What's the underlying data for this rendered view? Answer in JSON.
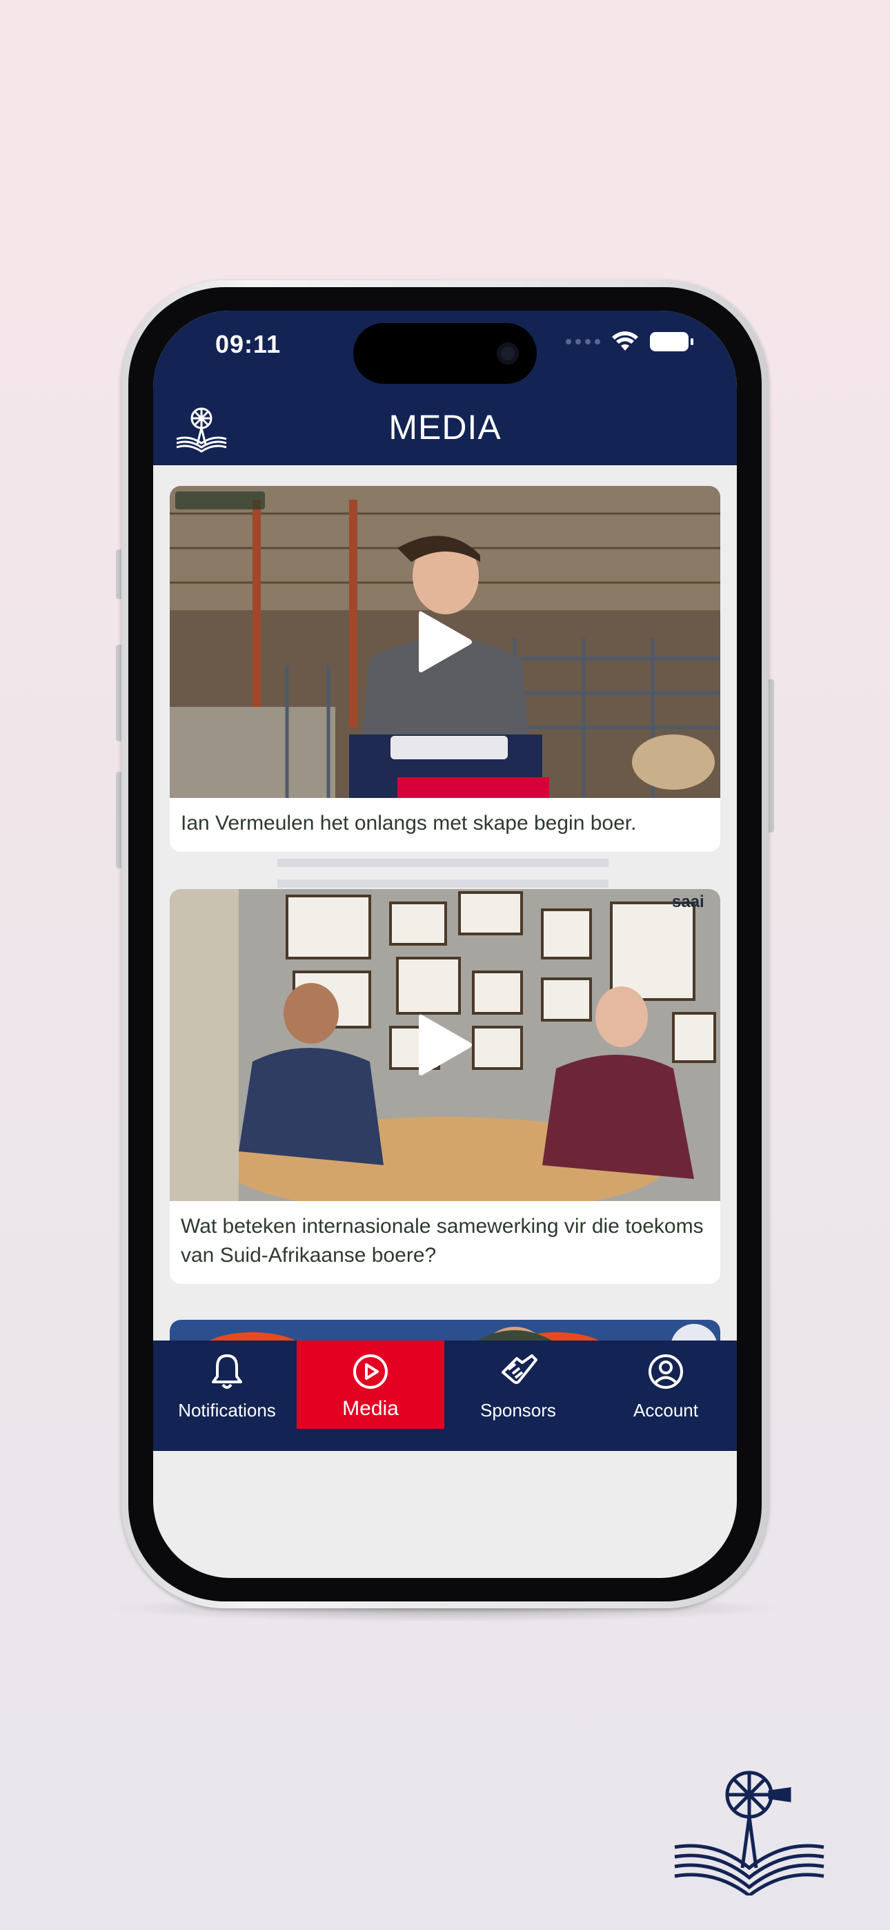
{
  "status_bar": {
    "time": "09:11"
  },
  "header": {
    "title": "MEDIA"
  },
  "videos": [
    {
      "caption": "Ian Vermeulen het onlangs met skape begin boer."
    },
    {
      "caption": "Wat beteken internasionale samewerking vir die toekoms van Suid-Afrikaanse boere?"
    },
    {
      "caption": ""
    }
  ],
  "tabs": [
    {
      "label": "Notifications",
      "icon": "bell-icon"
    },
    {
      "label": "Media",
      "icon": "play-circle-icon",
      "active": true
    },
    {
      "label": "Sponsors",
      "icon": "handshake-icon"
    },
    {
      "label": "Account",
      "icon": "user-circle-icon"
    }
  ],
  "colors": {
    "navy": "#132353",
    "accent_red": "#e30020"
  }
}
